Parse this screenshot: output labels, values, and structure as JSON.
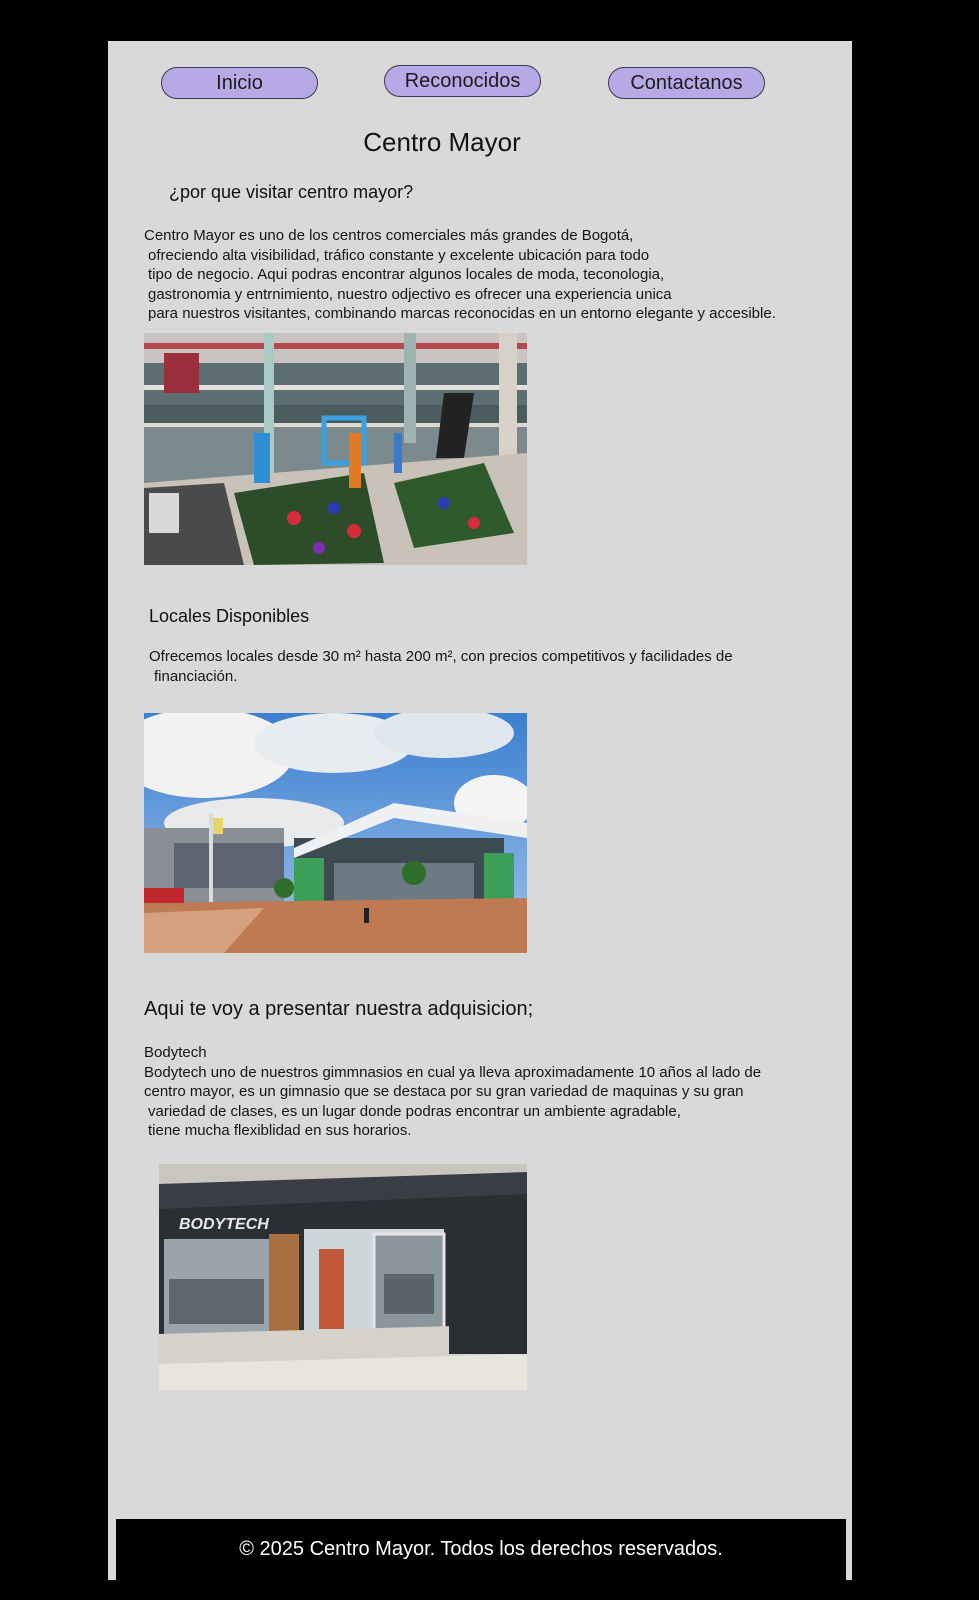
{
  "nav": {
    "inicio": "Inicio",
    "reconocidos": "Reconocidos",
    "contactanos": "Contactanos"
  },
  "header": {
    "title": "Centro Mayor",
    "question": "¿por que visitar centro mayor?"
  },
  "intro": {
    "lines": [
      "Centro Mayor es uno de los centros comerciales más grandes de Bogotá,",
      "ofreciendo alta visibilidad, tráfico constante y excelente ubicación para todo",
      "tipo de negocio. Aqui podras encontrar algunos locales de moda, teconologia,",
      "gastronomia y entrnimiento, nuestro odjectivo es ofrecer una experiencia unica",
      "para nuestros visitantes, combinando marcas reconocidas en un entorno elegante y accesible."
    ]
  },
  "locales": {
    "title": "Locales Disponibles",
    "lines": [
      "Ofrecemos locales desde 30 m² hasta 200 m², con precios competitivos y facilidades de",
      "financiación."
    ]
  },
  "adquisicion": {
    "title": "Aqui te voy a presentar nuestra adquisicion;",
    "lines": [
      "Bodytech",
      "Bodytech uno de nuestros gimmnasios en cual ya lleva aproximadamente 10 años al lado de",
      "centro mayor, es un gimnasio que se destaca por su gran variedad de maquinas y su gran",
      "variedad de clases, es un lugar donde podras encontrar un ambiente agradable,",
      "tiene mucha flexiblidad en sus horarios."
    ],
    "store_sign": "BODYTECH"
  },
  "footer": {
    "text": "© 2025 Centro Mayor. Todos los derechos reservados."
  },
  "colors": {
    "page_bg": "#d9d9d9",
    "outer_bg": "#000000",
    "nav_button": "#b6a9e6",
    "footer_bg": "#000000"
  }
}
